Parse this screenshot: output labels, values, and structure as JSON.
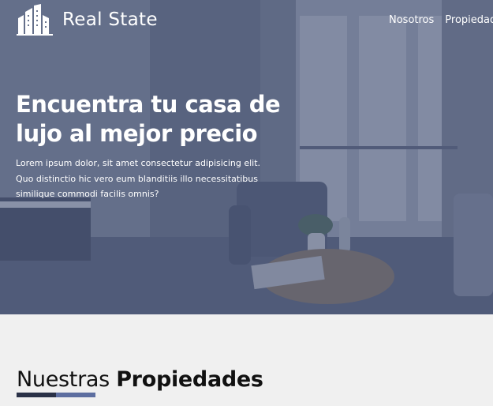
{
  "header": {
    "logo_text": "Real State",
    "logo_icon": "buildings-icon",
    "nav": [
      "Nosotros",
      "Propiedades"
    ]
  },
  "hero": {
    "title": "Encuentra tu casa de lujo al mejor precio",
    "text": "Lorem ipsum dolor, sit amet consectetur adipisicing elit. Quo distinctio hic vero eum blanditiis illo necessitatibus similique commodi facilis omnis?"
  },
  "section": {
    "title_light": "Nuestras",
    "title_bold": "Propiedades"
  },
  "colors": {
    "overlay": "#485473",
    "underline_dark": "#2a3147",
    "underline_accent": "#5d6ea0",
    "page_background": "#f0f0f0"
  }
}
